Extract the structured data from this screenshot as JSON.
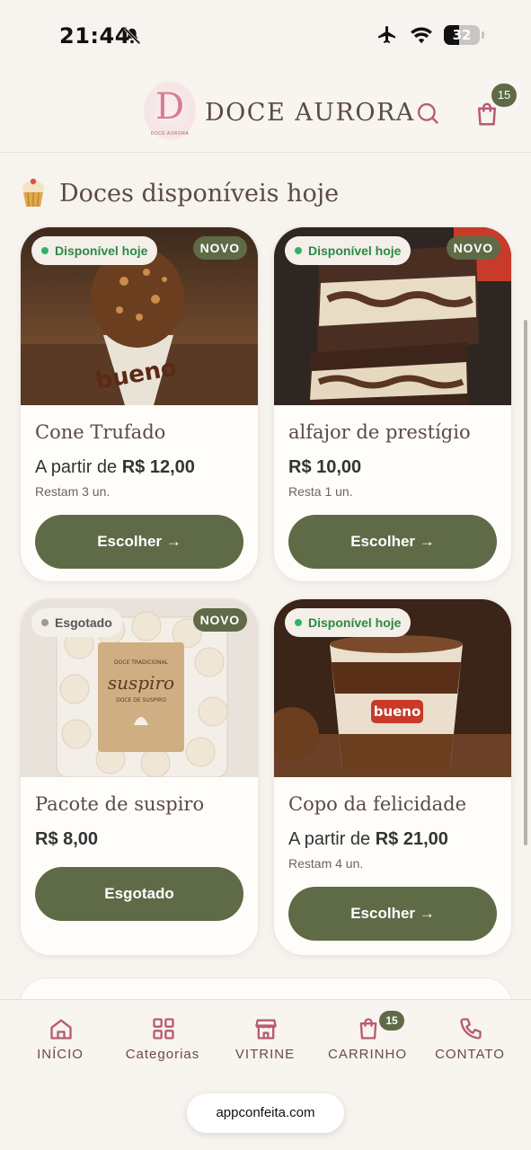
{
  "status_bar": {
    "time": "21:44",
    "battery": "32"
  },
  "header": {
    "logo_letter": "D",
    "logo_caption": "DOCE AURORA",
    "brand": "DOCE AURORA",
    "cart_count": "15",
    "icons": [
      "search-icon",
      "cart-icon"
    ]
  },
  "section": {
    "title": "Doces disponíveis hoje",
    "icon": "cupcake-icon"
  },
  "products": [
    {
      "status": "Disponível hoje",
      "badge": "NOVO",
      "name": "Cone Trufado",
      "price_prefix": "A partir de ",
      "price": "R$ 12,00",
      "stock": "Restam 3 un.",
      "button": "Escolher →"
    },
    {
      "status": "Disponível hoje",
      "badge": "NOVO",
      "name": "alfajor de prestígio",
      "price_prefix": "",
      "price": "R$ 10,00",
      "stock": "Resta 1 un.",
      "button": "Escolher →"
    },
    {
      "status": "Esgotado",
      "badge": "NOVO",
      "name": "Pacote de suspiro",
      "price_prefix": "",
      "price": "R$ 8,00",
      "stock": "",
      "button": "Esgotado",
      "image_text": {
        "top": "DOCE TRADICIONAL",
        "title": "suspiro",
        "sub": "DOCE DE SUSPIRO"
      }
    },
    {
      "status": "Disponível hoje",
      "badge": "",
      "name": "Copo da felicidade",
      "price_prefix": "A partir de ",
      "price": "R$ 21,00",
      "stock": "Restam 4 un.",
      "button": "Escolher →"
    }
  ],
  "bottom_nav": [
    {
      "label": "INÍCIO",
      "icon": "home-icon"
    },
    {
      "label": "Categorias",
      "icon": "grid-icon"
    },
    {
      "label": "VITRINE",
      "icon": "store-icon"
    },
    {
      "label": "CARRINHO",
      "icon": "cart-icon",
      "badge": "15"
    },
    {
      "label": "CONTATO",
      "icon": "phone-icon"
    }
  ],
  "browser": {
    "url": "appconfeita.com"
  },
  "colors": {
    "accent": "#5f6b46",
    "brand_pink": "#d77c93",
    "background": "#f7f3ee"
  }
}
